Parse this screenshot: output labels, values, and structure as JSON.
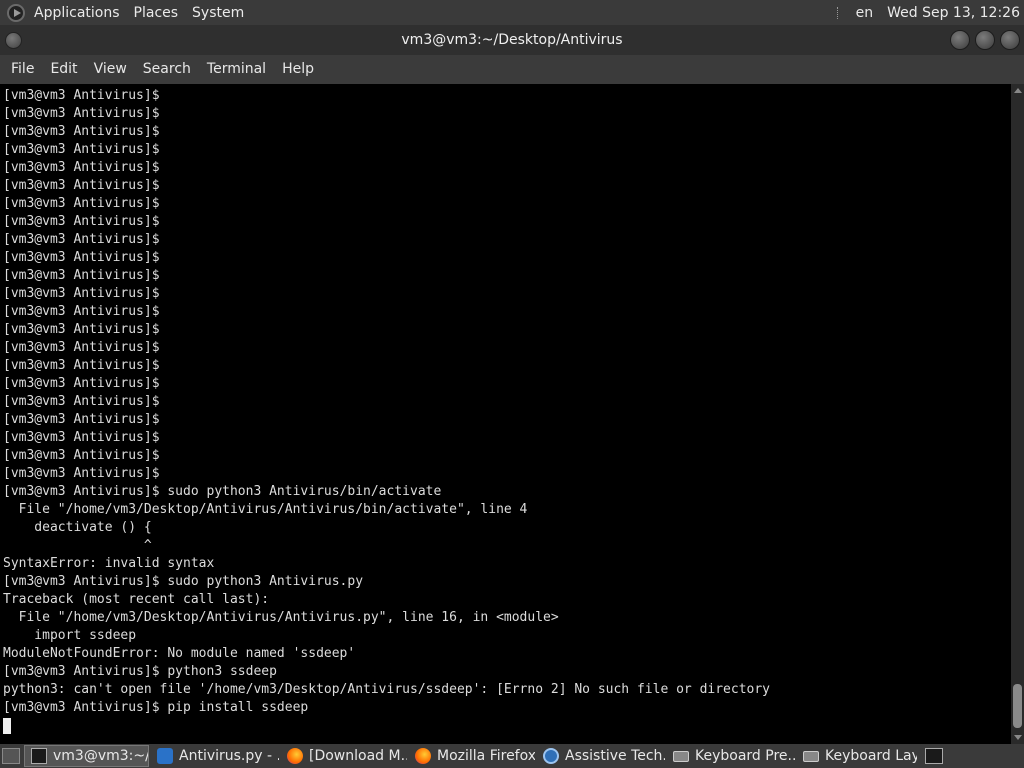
{
  "top_panel": {
    "applications": "Applications",
    "places": "Places",
    "system": "System",
    "lang": "en",
    "clock": "Wed Sep 13, 12:26"
  },
  "window": {
    "title": "vm3@vm3:~/Desktop/Antivirus"
  },
  "menu": {
    "file": "File",
    "edit": "Edit",
    "view": "View",
    "search": "Search",
    "terminal": "Terminal",
    "help": "Help"
  },
  "terminal": {
    "lines": [
      "[vm3@vm3 Antivirus]$",
      "[vm3@vm3 Antivirus]$",
      "[vm3@vm3 Antivirus]$",
      "[vm3@vm3 Antivirus]$",
      "[vm3@vm3 Antivirus]$",
      "[vm3@vm3 Antivirus]$",
      "[vm3@vm3 Antivirus]$",
      "[vm3@vm3 Antivirus]$",
      "[vm3@vm3 Antivirus]$",
      "[vm3@vm3 Antivirus]$",
      "[vm3@vm3 Antivirus]$",
      "[vm3@vm3 Antivirus]$",
      "[vm3@vm3 Antivirus]$",
      "[vm3@vm3 Antivirus]$",
      "[vm3@vm3 Antivirus]$",
      "[vm3@vm3 Antivirus]$",
      "[vm3@vm3 Antivirus]$",
      "[vm3@vm3 Antivirus]$",
      "[vm3@vm3 Antivirus]$",
      "[vm3@vm3 Antivirus]$",
      "[vm3@vm3 Antivirus]$",
      "[vm3@vm3 Antivirus]$",
      "[vm3@vm3 Antivirus]$ sudo python3 Antivirus/bin/activate",
      "  File \"/home/vm3/Desktop/Antivirus/Antivirus/bin/activate\", line 4",
      "    deactivate () {",
      "                  ^",
      "SyntaxError: invalid syntax",
      "[vm3@vm3 Antivirus]$ sudo python3 Antivirus.py",
      "Traceback (most recent call last):",
      "  File \"/home/vm3/Desktop/Antivirus/Antivirus.py\", line 16, in <module>",
      "    import ssdeep",
      "ModuleNotFoundError: No module named 'ssdeep'",
      "[vm3@vm3 Antivirus]$ python3 ssdeep",
      "python3: can't open file '/home/vm3/Desktop/Antivirus/ssdeep': [Errno 2] No such file or directory",
      "[vm3@vm3 Antivirus]$ pip install ssdeep"
    ]
  },
  "taskbar": {
    "tasks": [
      {
        "label": "vm3@vm3:~/...",
        "icon": "terminal-icon"
      },
      {
        "label": "Antivirus.py - ...",
        "icon": "vscode-icon"
      },
      {
        "label": "[Download M...",
        "icon": "firefox-icon"
      },
      {
        "label": "Mozilla Firefox",
        "icon": "firefox-icon"
      },
      {
        "label": "Assistive Tech...",
        "icon": "accessibility-icon"
      },
      {
        "label": "Keyboard Pre...",
        "icon": "keyboard-icon"
      },
      {
        "label": "Keyboard Lay...",
        "icon": "keyboard-icon"
      }
    ]
  }
}
